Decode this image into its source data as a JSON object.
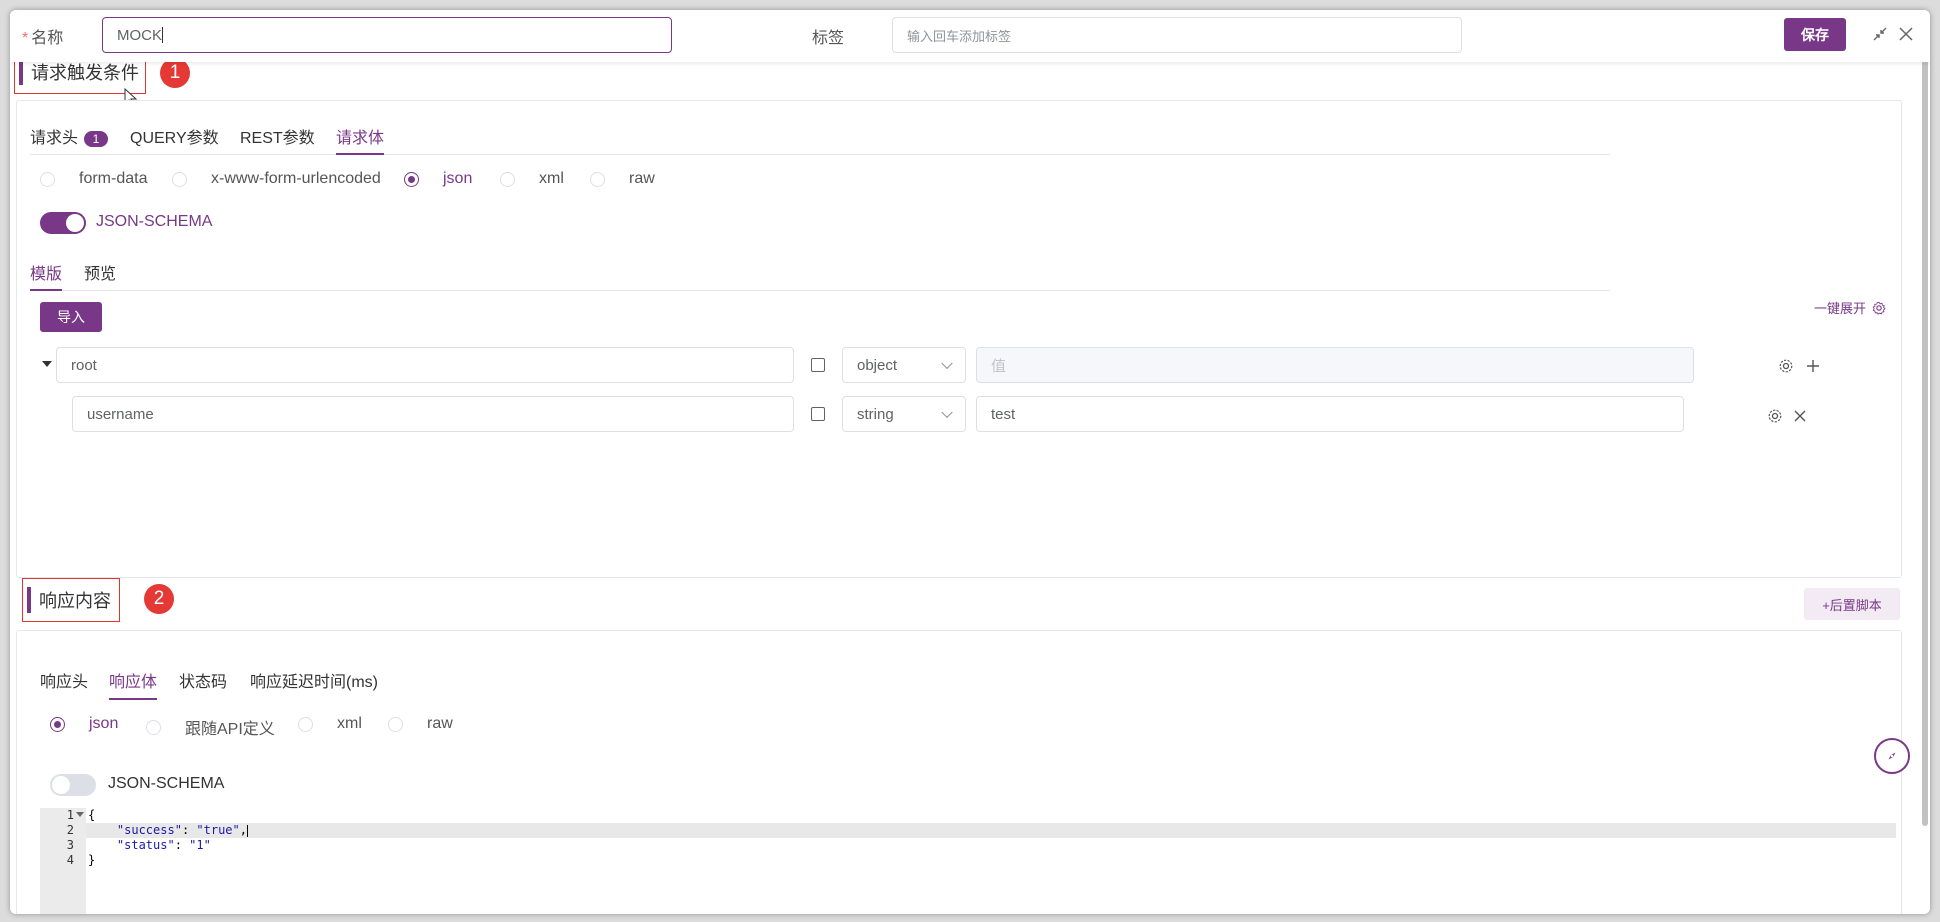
{
  "header": {
    "name_label": "名称",
    "name_value": "MOCK",
    "tag_label": "标签",
    "tag_placeholder": "输入回车添加标签",
    "save_label": "保存",
    "minimize_icon": "shrink-icon",
    "close_icon": "close-icon"
  },
  "trigger": {
    "title": "请求触发条件",
    "step": "1",
    "tabs": [
      {
        "label": "请求头",
        "badge": "1"
      },
      {
        "label": "QUERY参数"
      },
      {
        "label": "REST参数"
      },
      {
        "label": "请求体"
      }
    ],
    "active_tab": "请求体",
    "body_types": [
      "form-data",
      "x-www-form-urlencoded",
      "json",
      "xml",
      "raw"
    ],
    "selected_body_type": "json",
    "json_schema_label": "JSON-SCHEMA",
    "json_schema_enabled": true,
    "sub_tabs": [
      "模版",
      "预览"
    ],
    "active_sub_tab": "模版",
    "import_label": "导入",
    "expand_all_label": "一键展开",
    "rows": [
      {
        "name": "root",
        "type": "object",
        "value_placeholder": "值",
        "value": ""
      },
      {
        "name": "username",
        "type": "string",
        "value": "test"
      }
    ]
  },
  "response": {
    "title": "响应内容",
    "step": "2",
    "post_script_label": "+后置脚本",
    "tabs": [
      "响应头",
      "响应体",
      "状态码",
      "响应延迟时间(ms)"
    ],
    "active_tab": "响应体",
    "body_types": [
      "json",
      "跟随API定义",
      "xml",
      "raw"
    ],
    "selected_body_type": "json",
    "json_schema_label": "JSON-SCHEMA",
    "json_schema_enabled": false,
    "code_lines": [
      {
        "n": "1",
        "text": "{"
      },
      {
        "n": "2",
        "key": "\"success\"",
        "val": "\"true\"",
        "tail": ","
      },
      {
        "n": "3",
        "key": "\"status\"",
        "val": "\"1\"",
        "tail": ""
      },
      {
        "n": "4",
        "text": "}"
      }
    ]
  },
  "colors": {
    "accent": "#783887",
    "step_badge": "#e53935",
    "annotation_border": "#e0342c"
  }
}
